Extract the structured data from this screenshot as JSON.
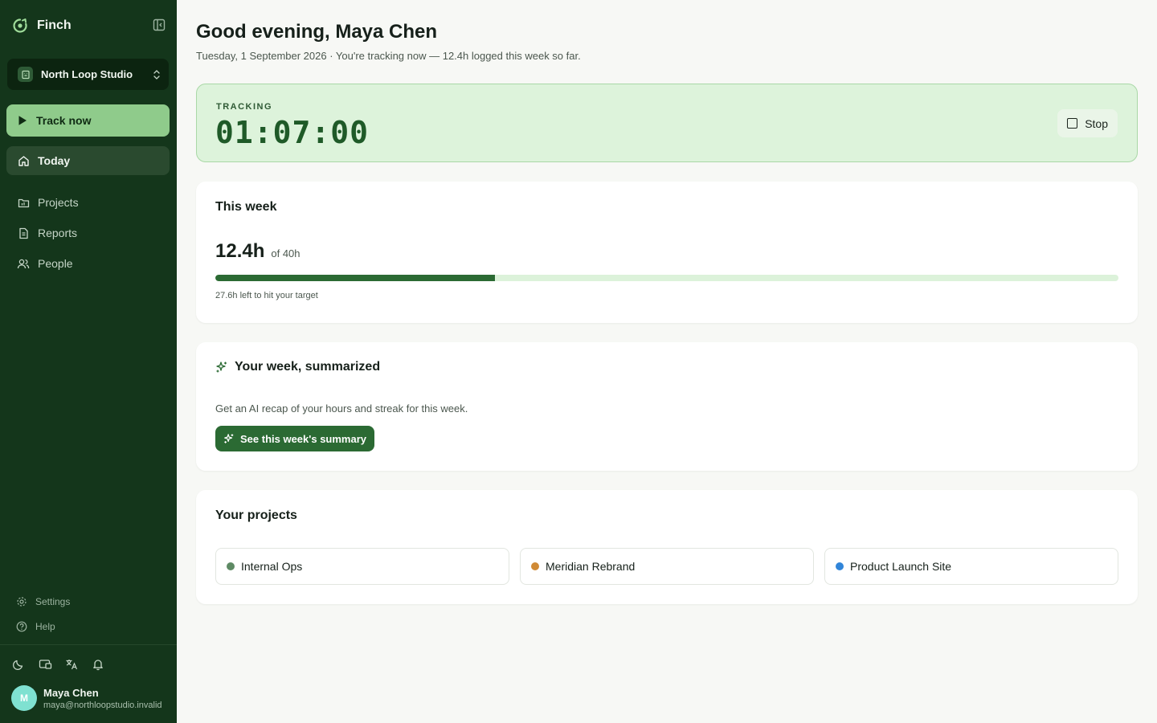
{
  "brand": {
    "name": "Finch"
  },
  "workspace": {
    "name": "North Loop Studio"
  },
  "sidebar": {
    "track_label": "Track now",
    "nav": [
      {
        "label": "Today",
        "icon": "home-icon",
        "active": true
      },
      {
        "label": "Projects",
        "icon": "folder-icon"
      },
      {
        "label": "Reports",
        "icon": "document-icon"
      },
      {
        "label": "People",
        "icon": "people-icon"
      }
    ],
    "settings_label": "Settings",
    "help_label": "Help",
    "utilities": [
      "moon-icon",
      "cast-icon",
      "translate-icon",
      "bell-icon"
    ]
  },
  "user": {
    "initial": "M",
    "name": "Maya Chen",
    "email": "maya@northloopstudio.invalid",
    "avatar_color": "#7fe1d1"
  },
  "header": {
    "greeting": "Good evening, Maya Chen",
    "subline": "Tuesday, 1 September 2026 · You're tracking now — 12.4h logged this week so far."
  },
  "tracking": {
    "label": "TRACKING",
    "timer": "01:07:00",
    "stop_label": "Stop"
  },
  "week": {
    "title": "This week",
    "hours": "12.4h",
    "target": "of 40h",
    "progress_fraction": 0.31,
    "left_text": "27.6h left to hit your target"
  },
  "summary": {
    "title": "Your week, summarized",
    "description": "Get an AI recap of your hours and streak for this week.",
    "button_label": "See this week's summary"
  },
  "projects": {
    "title": "Your projects",
    "items": [
      {
        "name": "Internal Ops",
        "color": "#5e8a64"
      },
      {
        "name": "Meridian Rebrand",
        "color": "#d08a35"
      },
      {
        "name": "Product Launch Site",
        "color": "#3185d9"
      }
    ]
  },
  "colors": {
    "sidebar_bg": "#14361b",
    "accent": "#2b6a33",
    "track_button": "#8fcb8b",
    "tracking_bg": "#ddf3db"
  }
}
